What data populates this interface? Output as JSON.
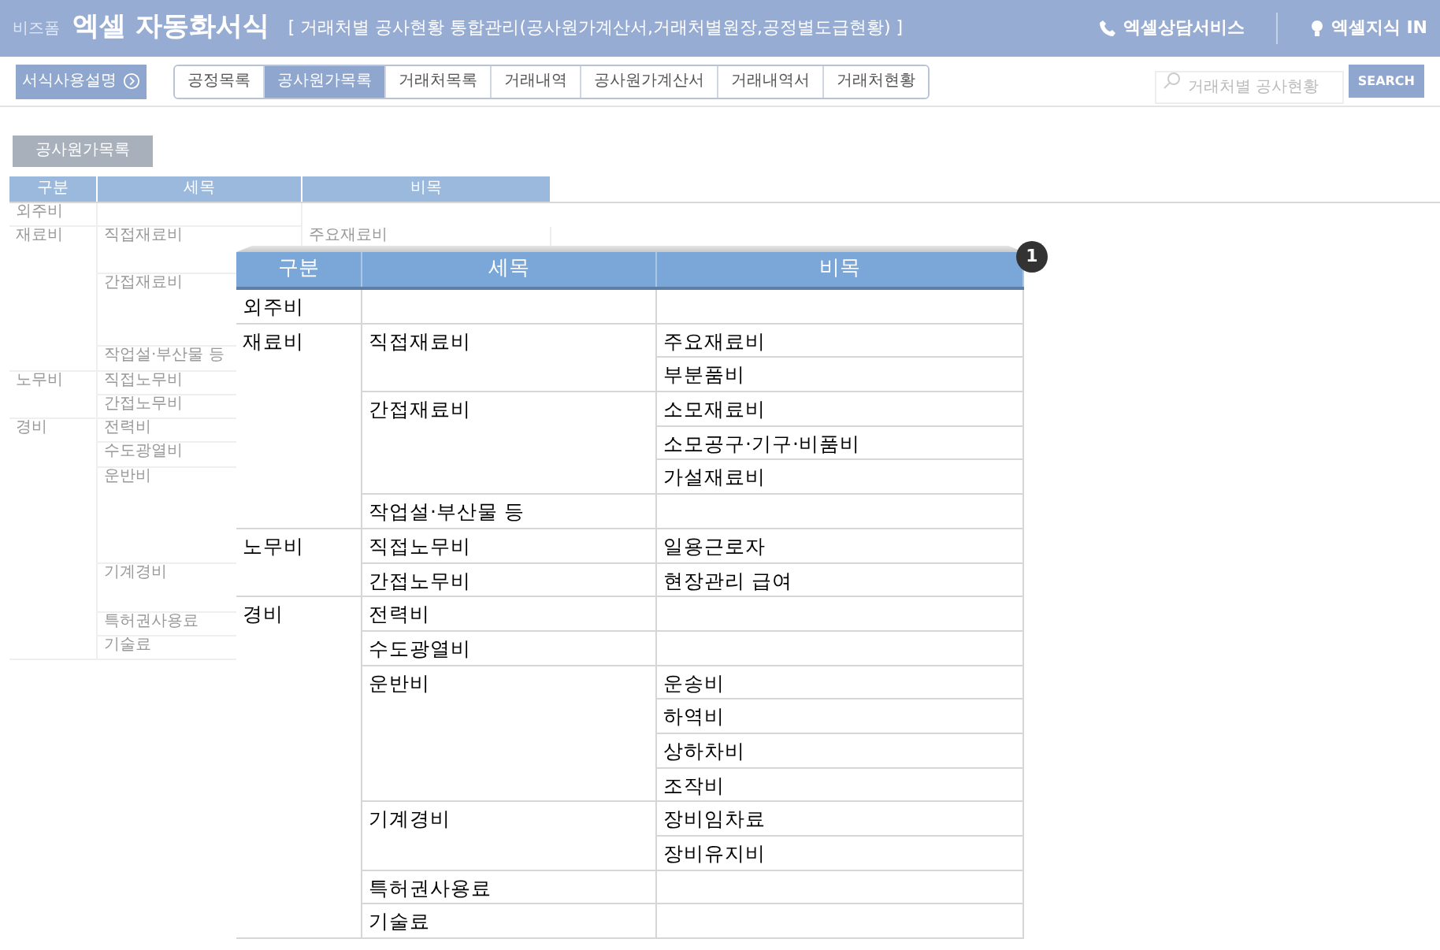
{
  "header": {
    "brand": "비즈폼",
    "title": "엑셀 자동화서식",
    "subtitle": "[ 거래처별 공사현황 통합관리(공사원가계산서,거래처별원장,공정별도급현황) ]",
    "links": [
      {
        "kind": "phone",
        "label": "엑셀상담서비스"
      },
      {
        "kind": "bulb",
        "label": "엑셀지식 IN"
      }
    ]
  },
  "toolbar": {
    "guide_button": "서식사용설명",
    "tabs": [
      {
        "label": "공정목록",
        "selected": false
      },
      {
        "label": "공사원가목록",
        "selected": true
      },
      {
        "label": "거래처목록",
        "selected": false
      },
      {
        "label": "거래내역",
        "selected": false
      },
      {
        "label": "공사원가계산서",
        "selected": false
      },
      {
        "label": "거래내역서",
        "selected": false
      },
      {
        "label": "거래처현황",
        "selected": false
      }
    ],
    "search": {
      "placeholder": "거래처별 공사현황",
      "button": "SEARCH"
    }
  },
  "sheet": {
    "title_button": "공사원가목록",
    "columns": [
      "구분",
      "세목",
      "비목"
    ],
    "categories": [
      {
        "name": "외주비"
      },
      {
        "name": "재료비",
        "subs": [
          {
            "name": "직접재료비",
            "items": [
              "주요재료비"
            ]
          },
          {
            "name": "간접재료비"
          },
          {
            "name": "작업설·부산물 등"
          }
        ]
      },
      {
        "name": "노무비",
        "subs": [
          {
            "name": "직접노무비"
          },
          {
            "name": "간접노무비"
          }
        ]
      },
      {
        "name": "경비",
        "subs": [
          {
            "name": "전력비"
          },
          {
            "name": "수도광열비"
          },
          {
            "name": "운반비"
          },
          {
            "name": "기계경비"
          },
          {
            "name": "특허권사용료"
          },
          {
            "name": "기술료"
          }
        ]
      }
    ]
  },
  "callout": {
    "badge": "1",
    "columns": [
      "구분",
      "세목",
      "비목"
    ],
    "categories": [
      {
        "name": "외주비"
      },
      {
        "name": "재료비",
        "subs": [
          {
            "name": "직접재료비",
            "items": [
              "주요재료비",
              "부분품비"
            ]
          },
          {
            "name": "간접재료비",
            "items": [
              "소모재료비",
              "소모공구·기구·비품비",
              "가설재료비"
            ]
          },
          {
            "name": "작업설·부산물 등"
          }
        ]
      },
      {
        "name": "노무비",
        "subs": [
          {
            "name": "직접노무비",
            "items": [
              "일용근로자"
            ]
          },
          {
            "name": "간접노무비",
            "items": [
              "현장관리 급여"
            ]
          }
        ]
      },
      {
        "name": "경비",
        "subs": [
          {
            "name": "전력비"
          },
          {
            "name": "수도광열비"
          },
          {
            "name": "운반비",
            "items": [
              "운송비",
              "하역비",
              "상하차비",
              "조작비"
            ]
          },
          {
            "name": "기계경비",
            "items": [
              "장비임차료",
              "장비유지비"
            ]
          },
          {
            "name": "특허권사용료"
          },
          {
            "name": "기술료"
          }
        ]
      }
    ]
  }
}
